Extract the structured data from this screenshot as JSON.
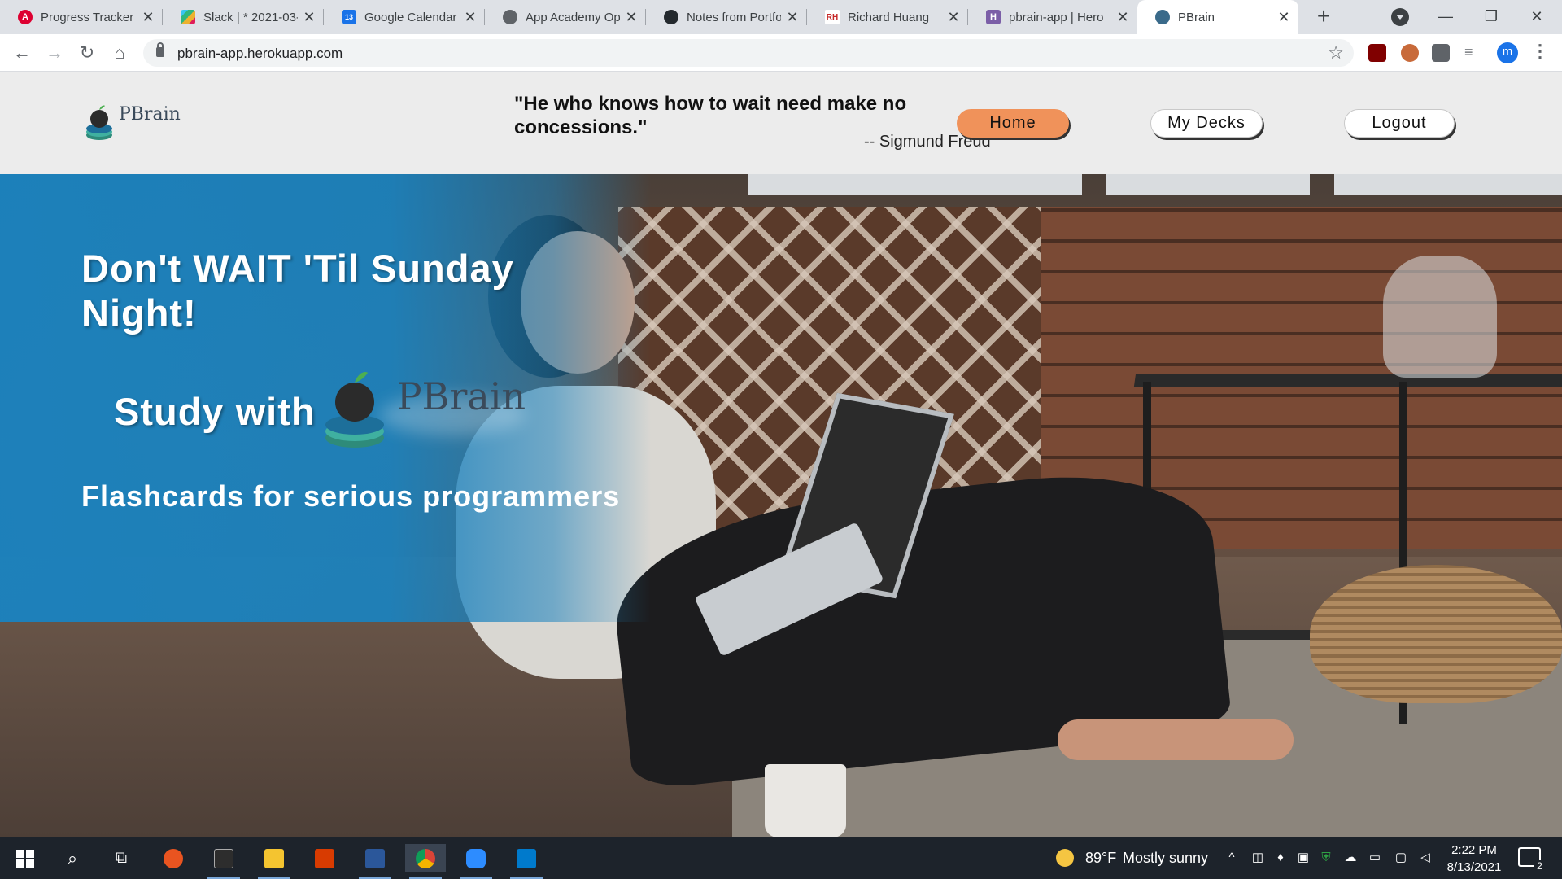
{
  "browser": {
    "tabs": [
      {
        "title": "Progress Tracker",
        "favicon": "angular-icon",
        "color": "#dd0031",
        "glyph": "A"
      },
      {
        "title": "Slack | * 2021-03-",
        "favicon": "slack-icon",
        "color": "#4a154b",
        "glyph": "#"
      },
      {
        "title": "Google Calendar -",
        "favicon": "calendar-icon",
        "color": "#1a73e8",
        "glyph": "13"
      },
      {
        "title": "App Academy Op",
        "favicon": "globe-icon",
        "color": "#5f6368",
        "glyph": "◍"
      },
      {
        "title": "Notes from Portfo",
        "favicon": "github-icon",
        "color": "#24292e",
        "glyph": "●"
      },
      {
        "title": "Richard Huang",
        "favicon": "rh-icon",
        "color": "#c62828",
        "glyph": "RH"
      },
      {
        "title": "pbrain-app | Hero",
        "favicon": "heroku-icon",
        "color": "#7b5ea7",
        "glyph": "H"
      },
      {
        "title": "PBrain",
        "favicon": "pbrain-icon",
        "color": "#3a6a8a",
        "glyph": "●"
      }
    ],
    "url": "pbrain-app.herokuapp.com",
    "profile_initial": "m"
  },
  "site": {
    "brand": "PBrain",
    "quote": "\"He who knows how to wait need make no concessions.\"",
    "quote_author": "-- Sigmund Freud",
    "nav": {
      "home": "Home",
      "my_decks": "My Decks",
      "logout": "Logout"
    },
    "hero": {
      "title": "Don't WAIT 'Til Sunday Night!",
      "study_with": "Study with",
      "study_brand": "PBrain",
      "tagline": "Flashcards for serious programmers"
    },
    "colors": {
      "accent_orange": "#f0925a",
      "hero_blue": "#1b82be"
    }
  },
  "taskbar": {
    "apps": [
      "start-icon",
      "search-icon",
      "task-view-icon",
      "ubuntu-icon",
      "terminal-icon",
      "file-explorer-icon",
      "office-icon",
      "word-icon",
      "chrome-icon",
      "zoom-icon",
      "vscode-icon"
    ],
    "weather_temp": "89°F",
    "weather_text": "Mostly sunny",
    "time": "2:22 PM",
    "date": "8/13/2021",
    "notification_count": "2"
  }
}
